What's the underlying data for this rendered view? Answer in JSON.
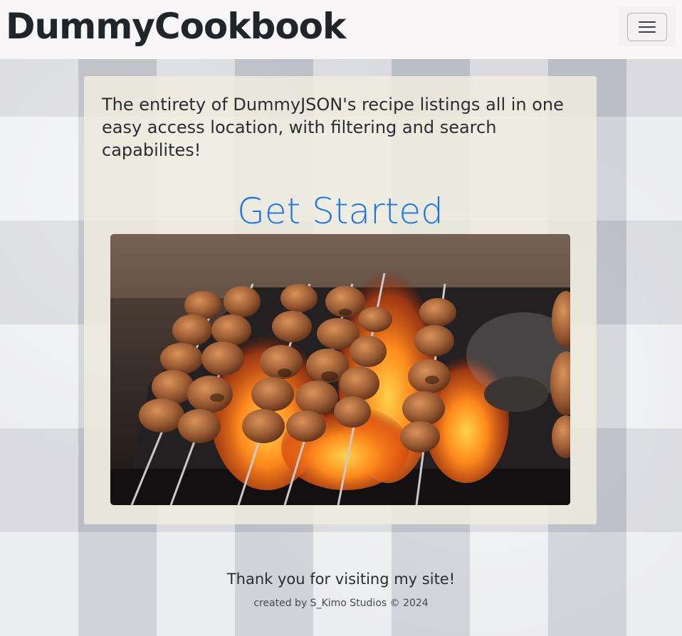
{
  "navbar": {
    "brand": "DummyCookbook",
    "toggler_icon": "hamburger-menu-icon",
    "background": "#f8f6f6"
  },
  "main": {
    "intro_text": "The entirety of DummyJSON's recipe listings all in one easy access location, with filtering and search capabilites!",
    "cta_label": "Get Started",
    "cta_color": "#1a73f0",
    "hero_image": "grilled-skewers-photo"
  },
  "footer": {
    "message": "Thank you for visiting my site!",
    "credit": "created by S_Kimo Studios © 2024"
  }
}
